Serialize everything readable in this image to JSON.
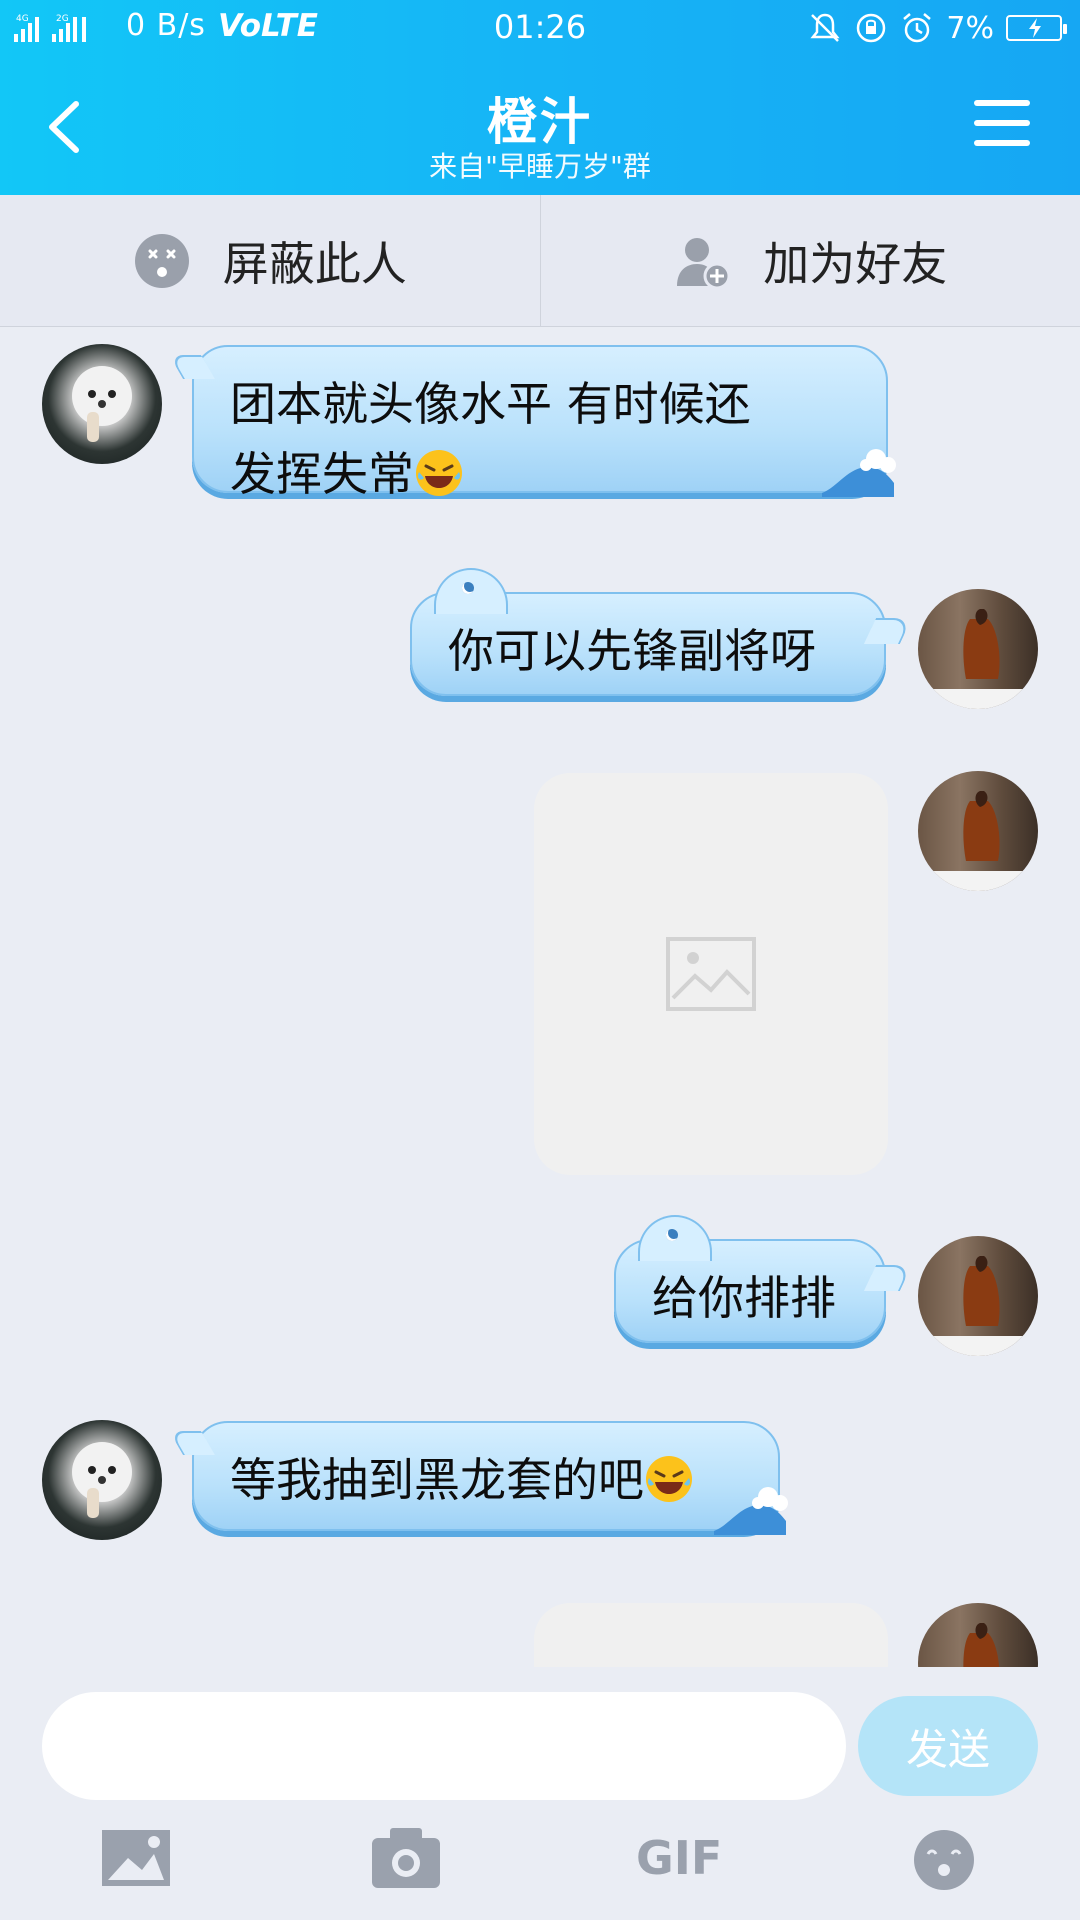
{
  "status_bar": {
    "network_speed": "0 B/s",
    "volte": "VoLTE",
    "time": "01:26",
    "battery_percent": "7%",
    "icons": [
      "signal-4g-icon",
      "signal-2g-icon",
      "mute-icon",
      "rotation-lock-icon",
      "alarm-icon",
      "battery-charging-icon"
    ]
  },
  "header": {
    "title": "橙汁",
    "subtitle": "来自\"早睡万岁\"群",
    "back_icon": "chevron-left-icon",
    "menu_icon": "hamburger-menu-icon"
  },
  "actions": {
    "block_label": "屏蔽此人",
    "add_friend_label": "加为好友"
  },
  "messages": [
    {
      "side": "left",
      "type": "text",
      "text": "团本就头像水平 有时候还",
      "text2": "发挥失常",
      "emoji": "face-with-tears-of-joy"
    },
    {
      "side": "right",
      "type": "text",
      "text": "你可以先锋副将呀"
    },
    {
      "side": "right",
      "type": "image"
    },
    {
      "side": "right",
      "type": "text",
      "text": "给你排排"
    },
    {
      "side": "left",
      "type": "text",
      "text": "等我抽到黑龙套的吧",
      "emoji": "face-with-tears-of-joy"
    },
    {
      "side": "right",
      "type": "image"
    }
  ],
  "input": {
    "placeholder": "",
    "value": "",
    "send_label": "发送"
  },
  "toolbar": {
    "items": [
      "image-icon",
      "camera-icon",
      "gif-icon",
      "emoji-face-icon"
    ],
    "gif_label": "GIF"
  },
  "colors": {
    "header_start": "#12c7f7",
    "header_end": "#16a7f3",
    "bubble": "#b9e1fb",
    "send_button": "#b4e4f8",
    "background": "#eaedf4"
  }
}
